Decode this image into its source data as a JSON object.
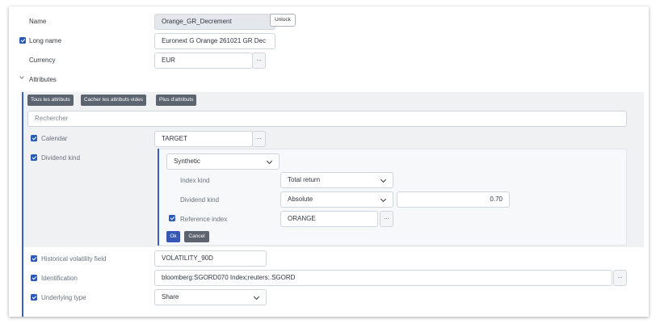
{
  "form": {
    "name_label": "Name",
    "name_value": "Orange_GR_Decrement",
    "unlock_label": "Unlock",
    "long_name_label": "Long name",
    "long_name_value": "Euronext G Orange 261021 GR Dec",
    "currency_label": "Currency",
    "currency_value": "EUR",
    "ellipsis": "..."
  },
  "attributes": {
    "section_label": "Attributes",
    "btn_all": "Tous les attributs",
    "btn_hide_empty": "Cacher les attributs vides",
    "btn_more": "Plus d'attributs",
    "search_placeholder": "Rechercher",
    "calendar_label": "Calendar",
    "calendar_value": "TARGET",
    "dividend_kind_label": "Dividend kind",
    "dividend": {
      "type_value": "Synthetic",
      "index_kind_label": "Index kind",
      "index_kind_value": "Total return",
      "dividend_kind_label": "Dividend kind",
      "dividend_kind_value": "Absolute",
      "amount_value": "0.70",
      "reference_index_label": "Reference index",
      "reference_index_value": "ORANGE",
      "ok_label": "Ok",
      "cancel_label": "Cancel"
    },
    "hist_vol_label": "Historical volatility field",
    "hist_vol_value": "VOLATILITY_90D",
    "identification_label": "Identification",
    "identification_value": "bloomberg:SGORD070 Index;reuters:.SGORD",
    "underlying_type_label": "Underlying type",
    "underlying_type_value": "Share"
  },
  "colors": {
    "accent": "#2b5bb8",
    "panel": "#f0f1f3",
    "button_gray": "#5c6470"
  }
}
